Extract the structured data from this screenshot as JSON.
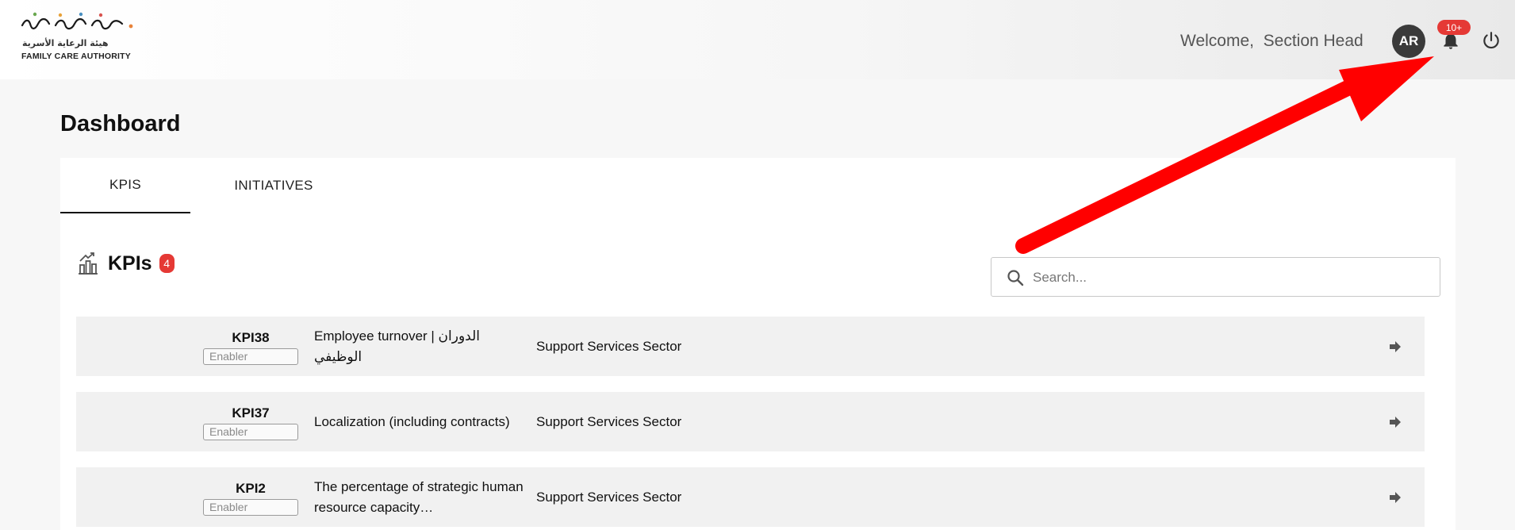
{
  "header": {
    "logo_ar": "هيئة الرعاية الأسرية",
    "logo_en": "FAMILY CARE AUTHORITY",
    "welcome": "Welcome,  Section Head",
    "avatar_initials": "AR",
    "notification_count": "10+",
    "icons": {
      "bell": "bell-icon",
      "power": "power-icon"
    }
  },
  "page": {
    "title": "Dashboard"
  },
  "tabs": [
    {
      "label": "KPIS",
      "active": true
    },
    {
      "label": "INITIATIVES",
      "active": false
    }
  ],
  "kpi_section": {
    "title": "KPIs",
    "count": "4",
    "search_placeholder": "Search..."
  },
  "rows": [
    {
      "code": "KPI38",
      "tag": "Enabler",
      "name": "Employee turnover | الدوران الوظيفي",
      "sector": "Support Services Sector"
    },
    {
      "code": "KPI37",
      "tag": "Enabler",
      "name": "Localization (including contracts)",
      "sector": "Support Services Sector"
    },
    {
      "code": "KPI2",
      "tag": "Enabler",
      "name": "The percentage of strategic human resource capacity…",
      "sector": "Support Services Sector"
    }
  ],
  "colors": {
    "accent_red": "#e53935",
    "annotation_arrow": "#ff0000",
    "avatar_bg": "#3a3a3a"
  }
}
